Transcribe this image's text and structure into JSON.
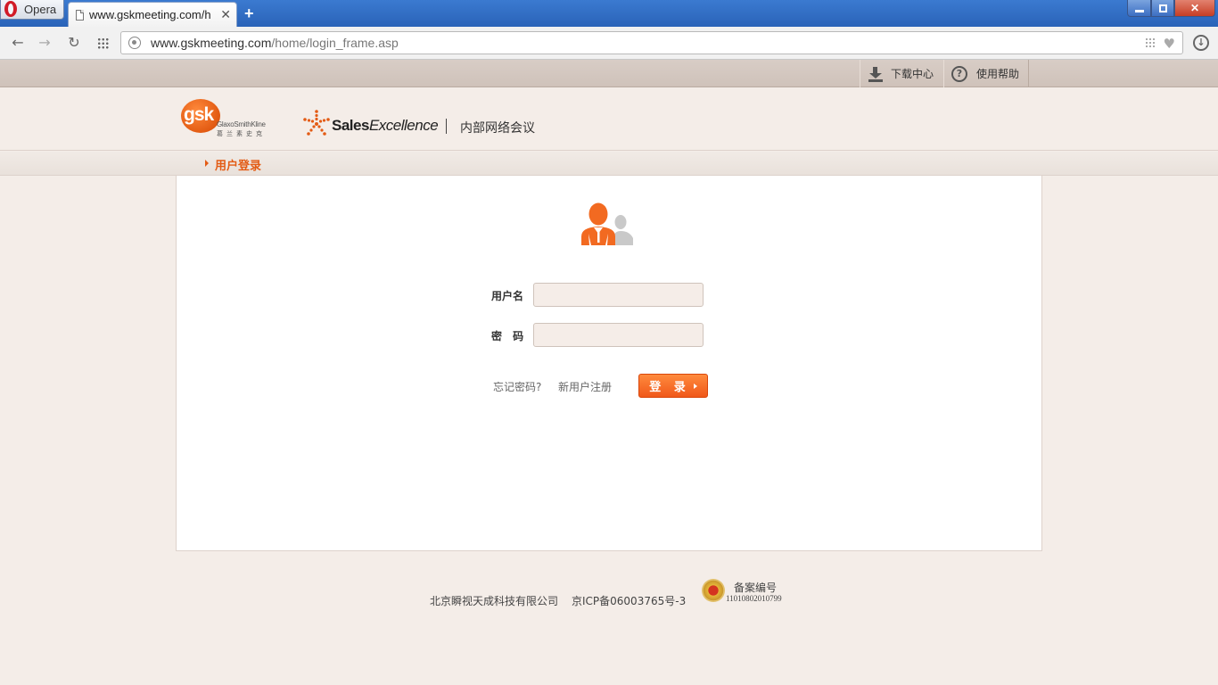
{
  "browser": {
    "menu_label": "Opera",
    "tab_title": "www.gskmeeting.com/h",
    "tab_close": "✕",
    "new_tab": "+",
    "url_host": "www.gskmeeting.com",
    "url_path": "/home/login_frame.asp"
  },
  "topbar": {
    "download": "下载中心",
    "help": "使用帮助"
  },
  "header": {
    "gsk_logo_text": "gsk",
    "gsk_name": "GlaxoSmithKline",
    "gsk_cn": "葛兰素史克",
    "brand_bold": "Sales",
    "brand_italic": "Excellence",
    "subtitle": "内部网络会议"
  },
  "section": {
    "title": "用户登录"
  },
  "form": {
    "username_label": "用户名",
    "password_label": "密 码",
    "username_value": "",
    "password_value": "",
    "forgot_link": "忘记密码?",
    "register_link": "新用户注册",
    "login_button": "登 录"
  },
  "footer": {
    "company": "北京瞬视天成科技有限公司",
    "icp": "京ICP备06003765号-3",
    "record_label": "备案编号",
    "record_number": "11010802010799"
  },
  "colors": {
    "accent": "#e35b14",
    "page_bg": "#f4ede8",
    "card_bg": "#ffffff"
  }
}
